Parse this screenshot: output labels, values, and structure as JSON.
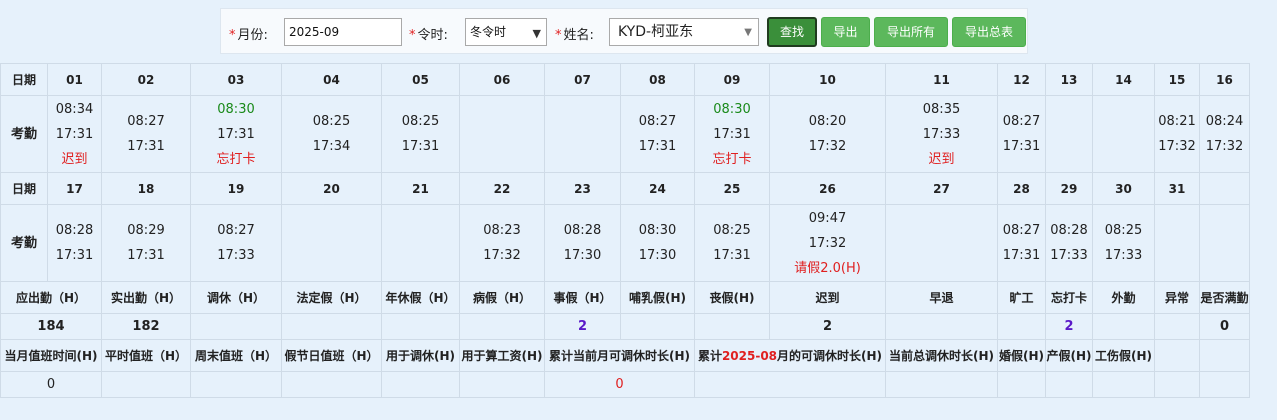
{
  "toolbar": {
    "month_label": "月份:",
    "month_value": "2025-09",
    "season_label": "令时:",
    "season_value": "冬令时",
    "name_label": "姓名:",
    "name_value": "KYD-柯亚东",
    "buttons": [
      "查找",
      "导出",
      "导出所有",
      "导出总表"
    ]
  },
  "calendar": {
    "row_header": "日期",
    "attendance_label": "考勤",
    "week1_days": [
      "01",
      "02",
      "03",
      "04",
      "05",
      "06",
      "07",
      "08",
      "09",
      "10",
      "11",
      "12",
      "13",
      "14",
      "15",
      "16"
    ],
    "week1_times": [
      {
        "in": "08:34",
        "out": "17:31",
        "note": "迟到"
      },
      {
        "in": "08:27",
        "out": "17:31",
        "note": ""
      },
      {
        "in": "08:30",
        "out": "17:31",
        "note": "忘打卡"
      },
      {
        "in": "08:25",
        "out": "17:34",
        "note": ""
      },
      {
        "in": "08:25",
        "out": "17:31",
        "note": ""
      },
      {
        "in": "",
        "out": "",
        "note": ""
      },
      {
        "in": "",
        "out": "",
        "note": ""
      },
      {
        "in": "08:27",
        "out": "17:31",
        "note": ""
      },
      {
        "in": "08:30",
        "out": "17:31",
        "note": "忘打卡"
      },
      {
        "in": "08:20",
        "out": "17:32",
        "note": ""
      },
      {
        "in": "08:35",
        "out": "17:33",
        "note": "迟到"
      },
      {
        "in": "08:27",
        "out": "17:31",
        "note": ""
      },
      {
        "in": "",
        "out": "",
        "note": ""
      },
      {
        "in": "",
        "out": "",
        "note": ""
      },
      {
        "in": "08:21",
        "out": "17:32",
        "note": ""
      },
      {
        "in": "08:24",
        "out": "17:32",
        "note": ""
      }
    ],
    "week2_days": [
      "17",
      "18",
      "19",
      "20",
      "21",
      "22",
      "23",
      "24",
      "25",
      "26",
      "27",
      "28",
      "29",
      "30",
      "31",
      ""
    ],
    "week2_times": [
      {
        "in": "08:28",
        "out": "17:31",
        "note": ""
      },
      {
        "in": "08:29",
        "out": "17:31",
        "note": ""
      },
      {
        "in": "08:27",
        "out": "17:33",
        "note": ""
      },
      {
        "in": "",
        "out": "",
        "note": ""
      },
      {
        "in": "",
        "out": "",
        "note": ""
      },
      {
        "in": "08:23",
        "out": "17:32",
        "note": ""
      },
      {
        "in": "08:28",
        "out": "17:30",
        "note": ""
      },
      {
        "in": "08:30",
        "out": "17:30",
        "note": ""
      },
      {
        "in": "08:25",
        "out": "17:31",
        "note": ""
      },
      {
        "in": "09:47",
        "out": "17:32",
        "note": "请假2.0(H)"
      },
      {
        "in": "",
        "out": "",
        "note": ""
      },
      {
        "in": "08:27",
        "out": "17:31",
        "note": ""
      },
      {
        "in": "08:28",
        "out": "17:33",
        "note": ""
      },
      {
        "in": "08:25",
        "out": "17:33",
        "note": ""
      },
      {
        "in": "",
        "out": "",
        "note": ""
      },
      {
        "in": "",
        "out": "",
        "note": ""
      }
    ]
  },
  "summary1": {
    "headers": [
      "应出勤（H）",
      "实出勤（H）",
      "调休（H）",
      "法定假（H）",
      "年休假（H）",
      "病假（H）",
      "事假（H）",
      "哺乳假(H)",
      "丧假(H)",
      "迟到",
      "早退",
      "旷工",
      "忘打卡",
      "外勤",
      "异常",
      "是否满勤"
    ],
    "values": [
      "184",
      "182",
      "",
      "",
      "",
      "",
      "2",
      "",
      "",
      "2",
      "",
      "",
      "2",
      "",
      "",
      "0"
    ]
  },
  "summary2": {
    "headers": [
      "当月值班时间(H)",
      "平时值班（H）",
      "周末值班（H）",
      "假节日值班（H）",
      "用于调休(H)",
      "用于算工资(H)",
      "累计当前月可调休时长(H)",
      "累计",
      "2025-08",
      "月的可调休时长(H)",
      "当前总调休时长(H)",
      "婚假(H)",
      "产假(H)",
      "工伤假(H)"
    ],
    "values": [
      "0",
      "0"
    ]
  },
  "colors": {
    "accent_green": "#5cb85c",
    "late_red": "#e02020",
    "ontime_green": "#1a8a1a",
    "count_purple": "#5a19c8"
  }
}
